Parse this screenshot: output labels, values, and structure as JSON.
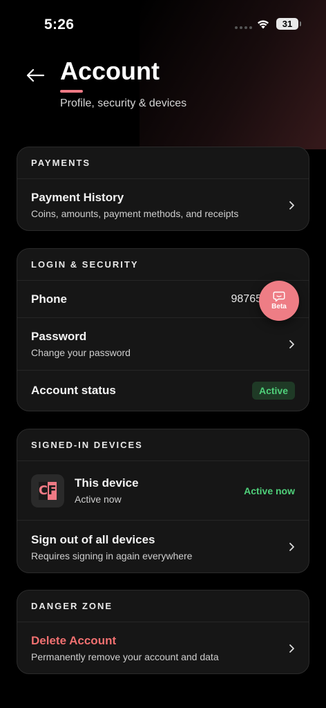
{
  "status_bar": {
    "time": "5:26",
    "battery": "31"
  },
  "header": {
    "title": "Account",
    "subtitle": "Profile, security & devices",
    "accent_color": "#ef7a85"
  },
  "payments": {
    "heading": "PAYMENTS",
    "history_title": "Payment History",
    "history_sub": "Coins, amounts, payment methods, and receipts"
  },
  "login": {
    "heading": "LOGIN & SECURITY",
    "phone_label": "Phone",
    "phone_value": "98765",
    "password_title": "Password",
    "password_sub": "Change your password",
    "status_label": "Account status",
    "status_badge": "Active"
  },
  "devices": {
    "heading": "SIGNED-IN DEVICES",
    "logo_letters": [
      "C",
      "F"
    ],
    "this_device_title": "This device",
    "this_device_sub": "Active now",
    "this_device_status": "Active now",
    "signout_title": "Sign out of all devices",
    "signout_sub": "Requires signing in again everywhere"
  },
  "danger": {
    "heading": "DANGER ZONE",
    "delete_title": "Delete Account",
    "delete_sub": "Permanently remove your account and data",
    "danger_color": "#f07070"
  },
  "fab": {
    "label": "Beta",
    "icon": "chat-bubble-icon"
  },
  "icons": {
    "back": "arrow-left-icon",
    "chevron": "chevron-right-icon",
    "wifi": "wifi-icon",
    "battery": "battery-icon"
  }
}
